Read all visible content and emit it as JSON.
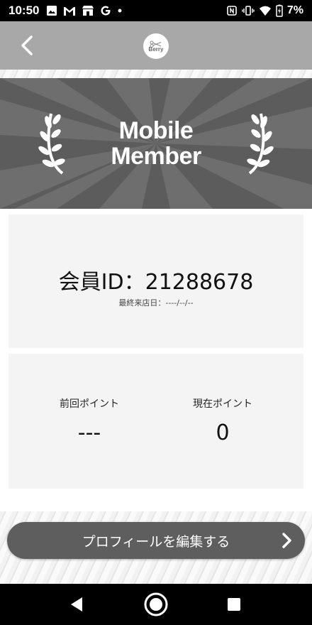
{
  "status_bar": {
    "time": "10:50",
    "battery_percent": "7%",
    "left_icons": [
      "image-icon",
      "gmail-icon",
      "store-icon",
      "google-icon",
      "dot-icon"
    ],
    "right_icons": [
      "nfc-icon",
      "vibrate-icon",
      "wifi-icon",
      "battery-charging-icon"
    ]
  },
  "header": {
    "back_icon": "chevron-left-icon",
    "logo_text": "Berry"
  },
  "banner": {
    "line1": "Mobile",
    "line2": "Member"
  },
  "member": {
    "id_text": "会員ID：21288678",
    "last_visit": "最終来店日：----/--/--"
  },
  "points": {
    "previous_label": "前回ポイント",
    "previous_value": "---",
    "current_label": "現在ポイント",
    "current_value": "0"
  },
  "edit_profile": {
    "label": "プロフィールを編集する"
  },
  "colors": {
    "header": "#a8a8a8",
    "banner": "#5c5c5c",
    "card": "#f4f4f4",
    "button": "#5e5e5e"
  }
}
